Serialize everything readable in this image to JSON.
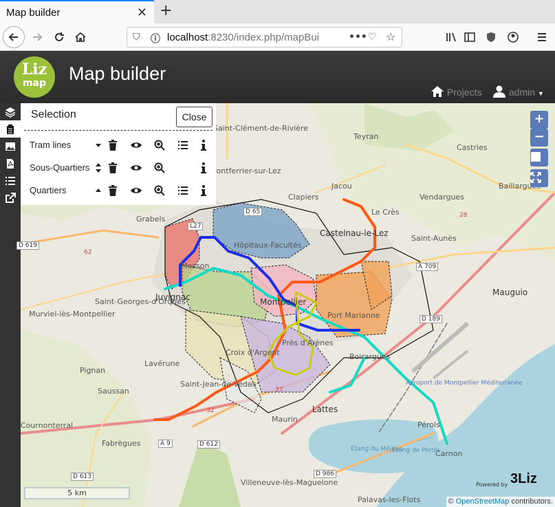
{
  "browser": {
    "tab_title": "Map builder",
    "url_host": "localhost",
    "url_rest": ":8230/index.php/mapBui"
  },
  "header": {
    "logo_top": "Liz",
    "logo_bottom": "map",
    "title": "Map builder",
    "projects_label": "Projects",
    "user_label": "admin"
  },
  "selection_panel": {
    "title": "Selection",
    "close_label": "Close",
    "layers": [
      {
        "name": "Tram lines",
        "order": "down",
        "has_table": true
      },
      {
        "name": "Sous-Quartiers",
        "order": "both",
        "has_table": false
      },
      {
        "name": "Quartiers",
        "order": "up",
        "has_table": true
      }
    ]
  },
  "map": {
    "zoom_in": "+",
    "zoom_out": "−",
    "scale_label": "5 km",
    "attribution_prefix": "©",
    "attribution_link": "OpenStreetMap",
    "attribution_suffix": "contributors.",
    "powered_by": "Powered by",
    "powered_brand": "3Liz",
    "place_labels": [
      "Saint-Clément-de-Rivière",
      "Teyran",
      "Castries",
      "Montferrier-sur-Lez",
      "Jacou",
      "Baillargues",
      "Vendargues",
      "Clapiers",
      "Le Crès",
      "Grabels",
      "Castelnau-le-Lez",
      "Saint-Aunès",
      "Hôpitaux-Facultés",
      "Mosson",
      "Juvignac",
      "Saint-Georges-d'Orques",
      "Murviel-lès-Montpellier",
      "Montpellier",
      "Port Marianne",
      "Mauguio",
      "Lavérune",
      "Croix d'Argent",
      "Près d'Arènes",
      "Boirargues",
      "Pignan",
      "Saussan",
      "Saint-Jean-de-Védas",
      "Aéroport de Montpellier Méditerranée",
      "Lattes",
      "Fabrègues",
      "Maurin",
      "Pérols",
      "Carnon",
      "Villeneuve-lès-Maguelone",
      "Palavas-les-Flots",
      "Étang du Méjean",
      "Étang de Pérols",
      "Cournonterral"
    ],
    "road_labels": [
      "D 65",
      "L27",
      "D 619",
      "A 709",
      "D 189",
      "A 9",
      "D 612",
      "D 613",
      "D 986",
      "37",
      "32",
      "62",
      "28"
    ]
  },
  "colors": {
    "tram_line_1": "#16d8c4",
    "tram_line_2": "#ff5a14",
    "tram_line_3": "#1b2ee8",
    "tram_line_4": "#c8cd10",
    "map_accent": "#5a7ab8"
  }
}
